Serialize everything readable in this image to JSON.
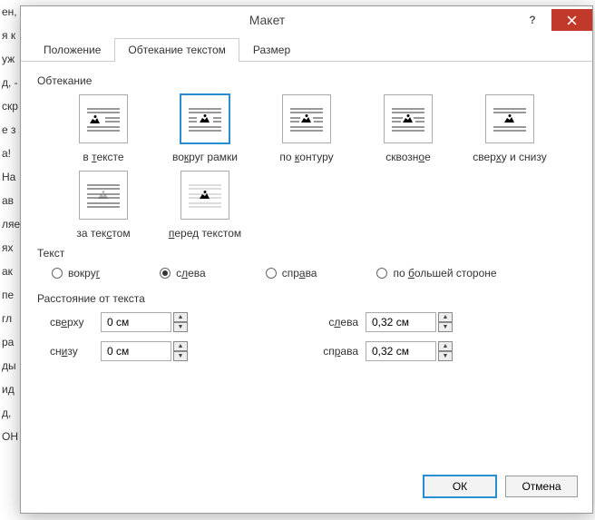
{
  "bg_lines": [
    "ен,",
    "",
    "я к",
    "уж",
    "д, -",
    "скр",
    "е з",
    "а!",
    "На",
    "ав",
    "ляе",
    "ях",
    "ак",
    "пе",
    "гл",
    "ра",
    "ды",
    "ид",
    "д, ",
    "ОН"
  ],
  "dialog": {
    "title": "Макет",
    "help": "?",
    "tabs": {
      "position": "Положение",
      "wrap": "Обтекание текстом",
      "size": "Размер"
    },
    "wrapping": {
      "label": "Обтекание",
      "options": {
        "inline": {
          "label_pre": "в ",
          "u": "т",
          "label_post": "ексте"
        },
        "square": {
          "label_pre": "во",
          "u": "к",
          "label_post": "руг рамки"
        },
        "tight": {
          "label_pre": "по ",
          "u": "к",
          "label_post": "онтуру"
        },
        "through": {
          "label_pre": "сквозн",
          "u": "о",
          "label_post": "е"
        },
        "topbot": {
          "label_pre": "свер",
          "u": "х",
          "label_post": "у и снизу"
        },
        "behind": {
          "label_pre": "за тек",
          "u": "с",
          "label_post": "том"
        },
        "front": {
          "label_pre": "",
          "u": "п",
          "label_post": "еред текстом"
        }
      },
      "selected": "square"
    },
    "text": {
      "label": "Текст",
      "options": {
        "around": {
          "pre": "вокру",
          "u": "г",
          "post": ""
        },
        "left": {
          "pre": "с",
          "u": "л",
          "post": "ева"
        },
        "right": {
          "pre": "спр",
          "u": "а",
          "post": "ва"
        },
        "long": {
          "pre": "по ",
          "u": "б",
          "post": "ольшей стороне"
        }
      },
      "selected": "left"
    },
    "distance": {
      "label": "Расстояние от текста",
      "top": {
        "label_pre": "св",
        "u": "е",
        "label_post": "рху",
        "value": "0 см"
      },
      "bottom": {
        "label_pre": "сн",
        "u": "и",
        "label_post": "зу",
        "value": "0 см"
      },
      "left": {
        "label_pre": "с",
        "u": "л",
        "label_post": "ева",
        "value": "0,32 см"
      },
      "right": {
        "label_pre": "сп",
        "u": "р",
        "label_post": "ава",
        "value": "0,32 см"
      }
    },
    "buttons": {
      "ok": "ОК",
      "cancel": "Отмена"
    }
  }
}
